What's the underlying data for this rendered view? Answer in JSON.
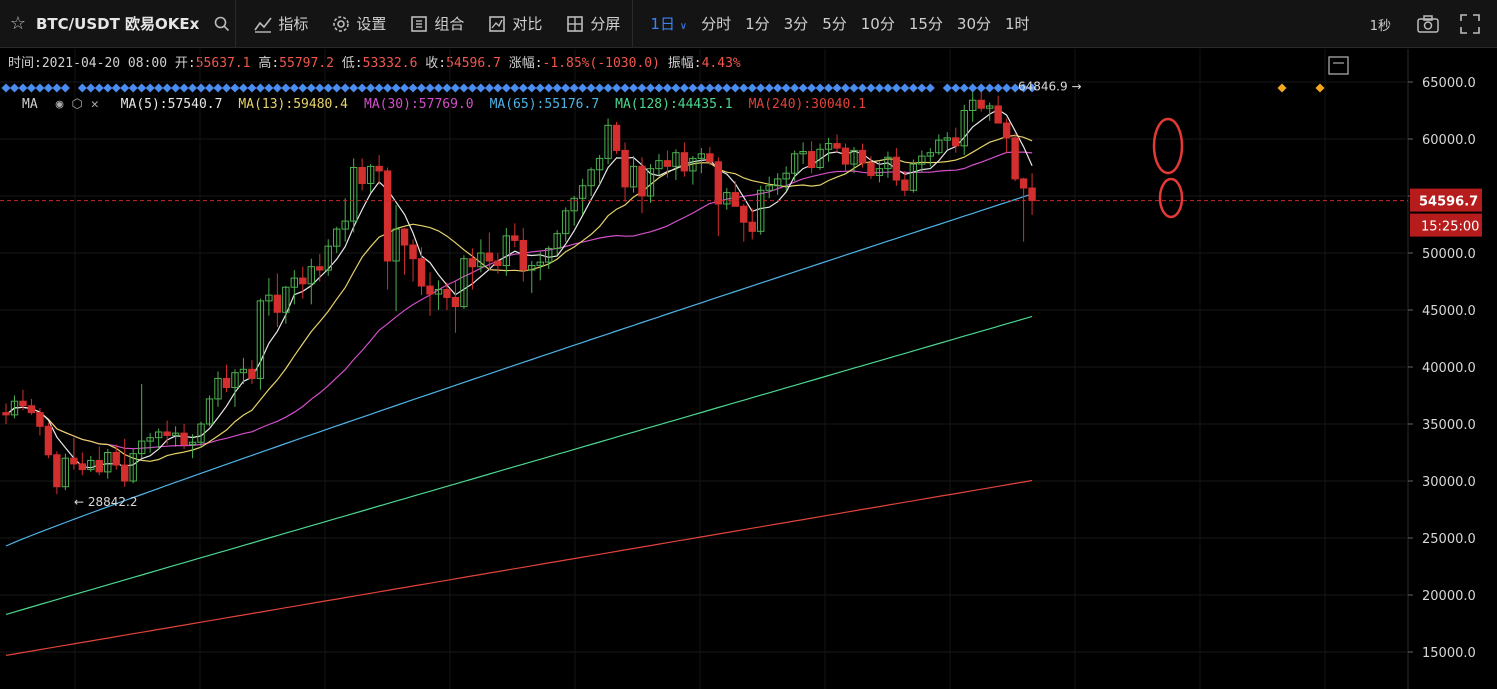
{
  "toolbar": {
    "symbol": "BTC/USDT 欧易OKEx",
    "tools": [
      "指标",
      "设置",
      "组合",
      "对比",
      "分屏"
    ],
    "active_interval": "1日",
    "intervals": [
      "分时",
      "1分",
      "3分",
      "5分",
      "10分",
      "15分",
      "30分",
      "1时"
    ],
    "seconds": "1秒"
  },
  "info": {
    "time_label": "时间:",
    "time": "2021-04-20 08:00",
    "open_label": "开:",
    "open": "55637.1",
    "high_label": "高:",
    "high": "55797.2",
    "low_label": "低:",
    "low": "53332.6",
    "close_label": "收:",
    "close": "54596.7",
    "change_label": "涨幅:",
    "change": "-1.85%(-1030.0)",
    "amplitude_label": "振幅:",
    "amplitude": "4.43%"
  },
  "ma_bar": {
    "label": "MA",
    "items": [
      {
        "text": "MA(5):57540.7",
        "color": "#e8e8e8"
      },
      {
        "text": "MA(13):59480.4",
        "color": "#e6d36a"
      },
      {
        "text": "MA(30):57769.0",
        "color": "#d24fc9"
      },
      {
        "text": "MA(65):55176.7",
        "color": "#4fb3e6"
      },
      {
        "text": "MA(128):44435.1",
        "color": "#4cd68f"
      },
      {
        "text": "MA(240):30040.1",
        "color": "#e0433a"
      }
    ]
  },
  "colors": {
    "up": "#4caf50",
    "down": "#d32f2f",
    "ma5": "#e8e8e8",
    "ma13": "#e6d36a",
    "ma30": "#d24fc9",
    "ma65": "#4fb3e6",
    "ma128": "#4cd68f",
    "ma240": "#e0433a",
    "price_tag": "#b71c1c",
    "marker": "#4a8cf0",
    "marker_alt": "#f5a623"
  },
  "chart_data": {
    "type": "candlestick",
    "y_ticks": [
      "65000.0",
      "60000.0",
      "55000.0",
      "50000.0",
      "45000.0",
      "40000.0",
      "35000.0",
      "30000.0",
      "25000.0",
      "20000.0",
      "15000.0"
    ],
    "ylim": [
      13000,
      67500
    ],
    "last_price": "54596.7",
    "countdown": "15:25:00",
    "high_annotation": "64846.9",
    "low_annotation": "28842.2",
    "grid": true,
    "candles": [
      [
        36000,
        36800,
        35000,
        35800
      ],
      [
        35800,
        37500,
        35500,
        37000
      ],
      [
        37000,
        38000,
        36200,
        36600
      ],
      [
        36600,
        37200,
        35800,
        36000
      ],
      [
        36000,
        36400,
        34000,
        34800
      ],
      [
        34800,
        35100,
        32000,
        32300
      ],
      [
        32300,
        32600,
        28842.2,
        29500
      ],
      [
        29500,
        32400,
        29200,
        32000
      ],
      [
        32000,
        33800,
        31000,
        31500
      ],
      [
        31500,
        32500,
        30500,
        31000
      ],
      [
        31000,
        32200,
        30800,
        31800
      ],
      [
        31800,
        33000,
        30500,
        30800
      ],
      [
        30800,
        32800,
        30200,
        32500
      ],
      [
        32500,
        33200,
        31000,
        31400
      ],
      [
        31400,
        33700,
        29500,
        30000
      ],
      [
        30000,
        32800,
        29800,
        32400
      ],
      [
        32400,
        38500,
        32000,
        33500
      ],
      [
        33500,
        34200,
        32500,
        33800
      ],
      [
        33800,
        34600,
        32800,
        34300
      ],
      [
        34300,
        35300,
        33200,
        34000
      ],
      [
        34000,
        34800,
        33000,
        34200
      ],
      [
        34200,
        35000,
        32800,
        33200
      ],
      [
        33200,
        34100,
        32000,
        33400
      ],
      [
        33400,
        35200,
        32900,
        35000
      ],
      [
        35000,
        37500,
        34800,
        37200
      ],
      [
        37200,
        39600,
        36500,
        39000
      ],
      [
        39000,
        40200,
        37800,
        38200
      ],
      [
        38200,
        39800,
        36500,
        39500
      ],
      [
        39500,
        40800,
        38500,
        39800
      ],
      [
        39800,
        40600,
        38500,
        39000
      ],
      [
        39000,
        46000,
        38000,
        45800
      ],
      [
        45800,
        47800,
        44500,
        46300
      ],
      [
        46300,
        48200,
        43500,
        44800
      ],
      [
        44800,
        47100,
        43800,
        47000
      ],
      [
        47000,
        48500,
        45500,
        47800
      ],
      [
        47800,
        48800,
        46000,
        47300
      ],
      [
        47300,
        49500,
        45500,
        48800
      ],
      [
        48800,
        49900,
        47500,
        48500
      ],
      [
        48500,
        51200,
        48000,
        50600
      ],
      [
        50600,
        52300,
        50000,
        52100
      ],
      [
        52100,
        54800,
        51000,
        52800
      ],
      [
        52800,
        58300,
        51800,
        57500
      ],
      [
        57500,
        58300,
        55500,
        56100
      ],
      [
        56100,
        57800,
        55300,
        57600
      ],
      [
        57600,
        58600,
        56000,
        57200
      ],
      [
        57200,
        57500,
        46800,
        49300
      ],
      [
        49300,
        54200,
        44900,
        52100
      ],
      [
        52100,
        52200,
        48100,
        50700
      ],
      [
        50700,
        51200,
        47500,
        49500
      ],
      [
        49500,
        50500,
        46300,
        47100
      ],
      [
        47100,
        48300,
        44500,
        46400
      ],
      [
        46400,
        47600,
        45000,
        46800
      ],
      [
        46800,
        47400,
        45000,
        46100
      ],
      [
        46100,
        47500,
        43000,
        45300
      ],
      [
        45300,
        49800,
        45100,
        49500
      ],
      [
        49500,
        50400,
        46800,
        48800
      ],
      [
        48800,
        51200,
        48300,
        50000
      ],
      [
        50000,
        51800,
        48500,
        49300
      ],
      [
        49300,
        50000,
        48200,
        48900
      ],
      [
        48900,
        52200,
        48000,
        51500
      ],
      [
        51500,
        52600,
        50500,
        51100
      ],
      [
        51100,
        52200,
        47500,
        48500
      ],
      [
        48500,
        49300,
        46500,
        48900
      ],
      [
        48900,
        50100,
        47600,
        49200
      ],
      [
        49200,
        50600,
        48600,
        50400
      ],
      [
        50400,
        52000,
        49800,
        51700
      ],
      [
        51700,
        54000,
        51000,
        53700
      ],
      [
        53700,
        55000,
        52400,
        54800
      ],
      [
        54800,
        56500,
        53400,
        55900
      ],
      [
        55900,
        57500,
        55000,
        57300
      ],
      [
        57300,
        58600,
        56000,
        58300
      ],
      [
        58300,
        61800,
        57800,
        61200
      ],
      [
        61200,
        61500,
        58700,
        59000
      ],
      [
        59000,
        59700,
        54500,
        55800
      ],
      [
        55800,
        58500,
        55300,
        57600
      ],
      [
        57600,
        58400,
        53500,
        55000
      ],
      [
        55000,
        57800,
        54400,
        57400
      ],
      [
        57400,
        58700,
        56800,
        58100
      ],
      [
        58100,
        59000,
        56600,
        57600
      ],
      [
        57600,
        59100,
        56400,
        58800
      ],
      [
        58800,
        59700,
        56700,
        57200
      ],
      [
        57200,
        58500,
        56000,
        58300
      ],
      [
        58300,
        59200,
        57000,
        58700
      ],
      [
        58700,
        59300,
        57700,
        58000
      ],
      [
        58000,
        58400,
        51500,
        54300
      ],
      [
        54300,
        55700,
        53800,
        55300
      ],
      [
        55300,
        56300,
        54200,
        54100
      ],
      [
        54100,
        54300,
        51000,
        52700
      ],
      [
        52700,
        53900,
        51200,
        51900
      ],
      [
        51900,
        55900,
        51600,
        55500
      ],
      [
        55500,
        56700,
        54800,
        55900
      ],
      [
        55900,
        57000,
        55100,
        56500
      ],
      [
        56500,
        57600,
        55500,
        57000
      ],
      [
        57000,
        59000,
        56300,
        58700
      ],
      [
        58700,
        59700,
        57800,
        58900
      ],
      [
        58900,
        59800,
        57000,
        57500
      ],
      [
        57500,
        59600,
        57300,
        59100
      ],
      [
        59100,
        60100,
        58000,
        59600
      ],
      [
        59600,
        60400,
        58800,
        59200
      ],
      [
        59200,
        59600,
        57200,
        57800
      ],
      [
        57800,
        59300,
        57000,
        59000
      ],
      [
        59000,
        59600,
        57500,
        57900
      ],
      [
        57900,
        58500,
        56500,
        56800
      ],
      [
        56800,
        58000,
        56200,
        57400
      ],
      [
        57400,
        58900,
        56600,
        58400
      ],
      [
        58400,
        59200,
        55900,
        56400
      ],
      [
        56400,
        57200,
        55000,
        55500
      ],
      [
        55500,
        58200,
        55300,
        57800
      ],
      [
        57800,
        59000,
        57100,
        58500
      ],
      [
        58500,
        59200,
        57600,
        58800
      ],
      [
        58800,
        60400,
        58600,
        59900
      ],
      [
        59900,
        60600,
        59100,
        60100
      ],
      [
        60100,
        61000,
        58800,
        59400
      ],
      [
        59400,
        63000,
        58600,
        62500
      ],
      [
        62500,
        64846.9,
        61500,
        63400
      ],
      [
        63400,
        64300,
        62400,
        62700
      ],
      [
        62700,
        63200,
        61600,
        62900
      ],
      [
        62900,
        63800,
        62000,
        61400
      ],
      [
        61400,
        61800,
        58800,
        60100
      ],
      [
        60100,
        60500,
        56300,
        56500
      ],
      [
        56500,
        56600,
        51000,
        55700
      ],
      [
        55700,
        57000,
        53332.6,
        54600
      ]
    ]
  }
}
